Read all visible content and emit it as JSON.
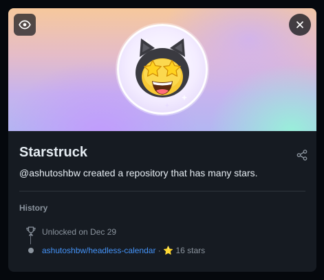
{
  "achievement": {
    "title": "Starstruck",
    "description": "@ashutoshbw created a repository that has many stars.",
    "badge_icon": "star-eyed-cat-icon"
  },
  "controls": {
    "visibility_icon": "eye-icon",
    "close_icon": "close-icon",
    "share_icon": "share-icon"
  },
  "history": {
    "label": "History",
    "unlocked_text": "Unlocked on Dec 29",
    "repo": "ashutoshbw/headless-calendar",
    "separator": "·",
    "star_glyph": "⭐",
    "stars_text": "16 stars"
  },
  "colors": {
    "card_bg": "#161b22",
    "text_primary": "#e6edf3",
    "text_muted": "#8b949e",
    "link": "#4493f8"
  }
}
